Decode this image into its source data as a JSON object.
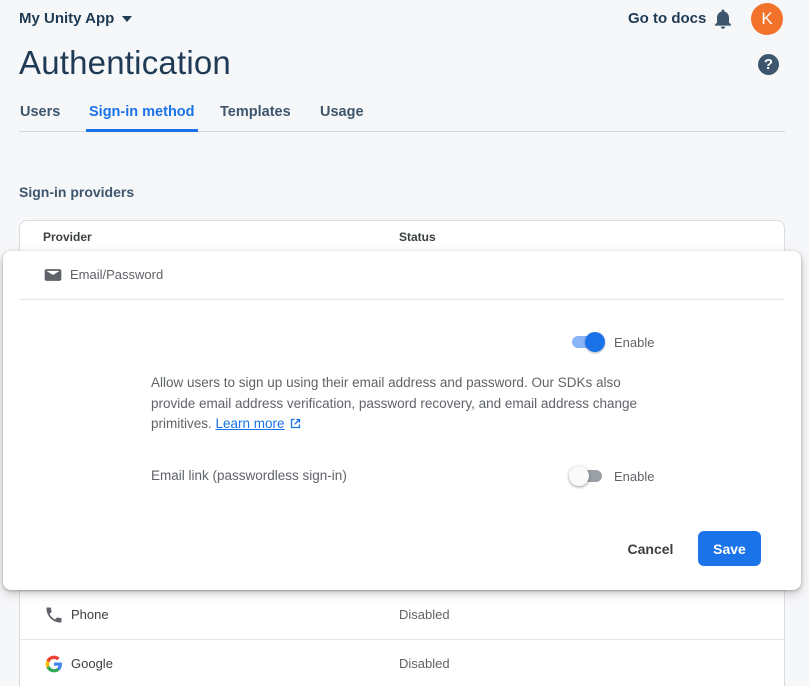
{
  "header": {
    "app_name": "My Unity App",
    "docs_link": "Go to docs",
    "avatar_initial": "K",
    "avatar_color": "#f2712b"
  },
  "page": {
    "title": "Authentication",
    "help_icon": "?"
  },
  "tabs": [
    {
      "label": "Users",
      "active": false
    },
    {
      "label": "Sign-in method",
      "active": true
    },
    {
      "label": "Templates",
      "active": false
    },
    {
      "label": "Usage",
      "active": false
    }
  ],
  "providers": {
    "section_title": "Sign-in providers",
    "columns": [
      "Provider",
      "Status"
    ],
    "expanded": {
      "name": "Email/Password",
      "icon": "mail-icon",
      "enable_toggle": {
        "label": "Enable",
        "on": true
      },
      "description": "Allow users to sign up using their email address and password. Our SDKs also provide email address verification, password recovery, and email address change primitives.",
      "learn_more": "Learn more",
      "email_link": {
        "label": "Email link (passwordless sign-in)",
        "toggle_label": "Enable",
        "on": false
      },
      "cancel_label": "Cancel",
      "save_label": "Save"
    },
    "rows": [
      {
        "name": "Phone",
        "status": "Disabled",
        "icon": "phone-icon"
      },
      {
        "name": "Google",
        "status": "Disabled",
        "icon": "google-icon"
      }
    ]
  },
  "colors": {
    "accent": "#1a73e8",
    "heading": "#1f3a54"
  }
}
